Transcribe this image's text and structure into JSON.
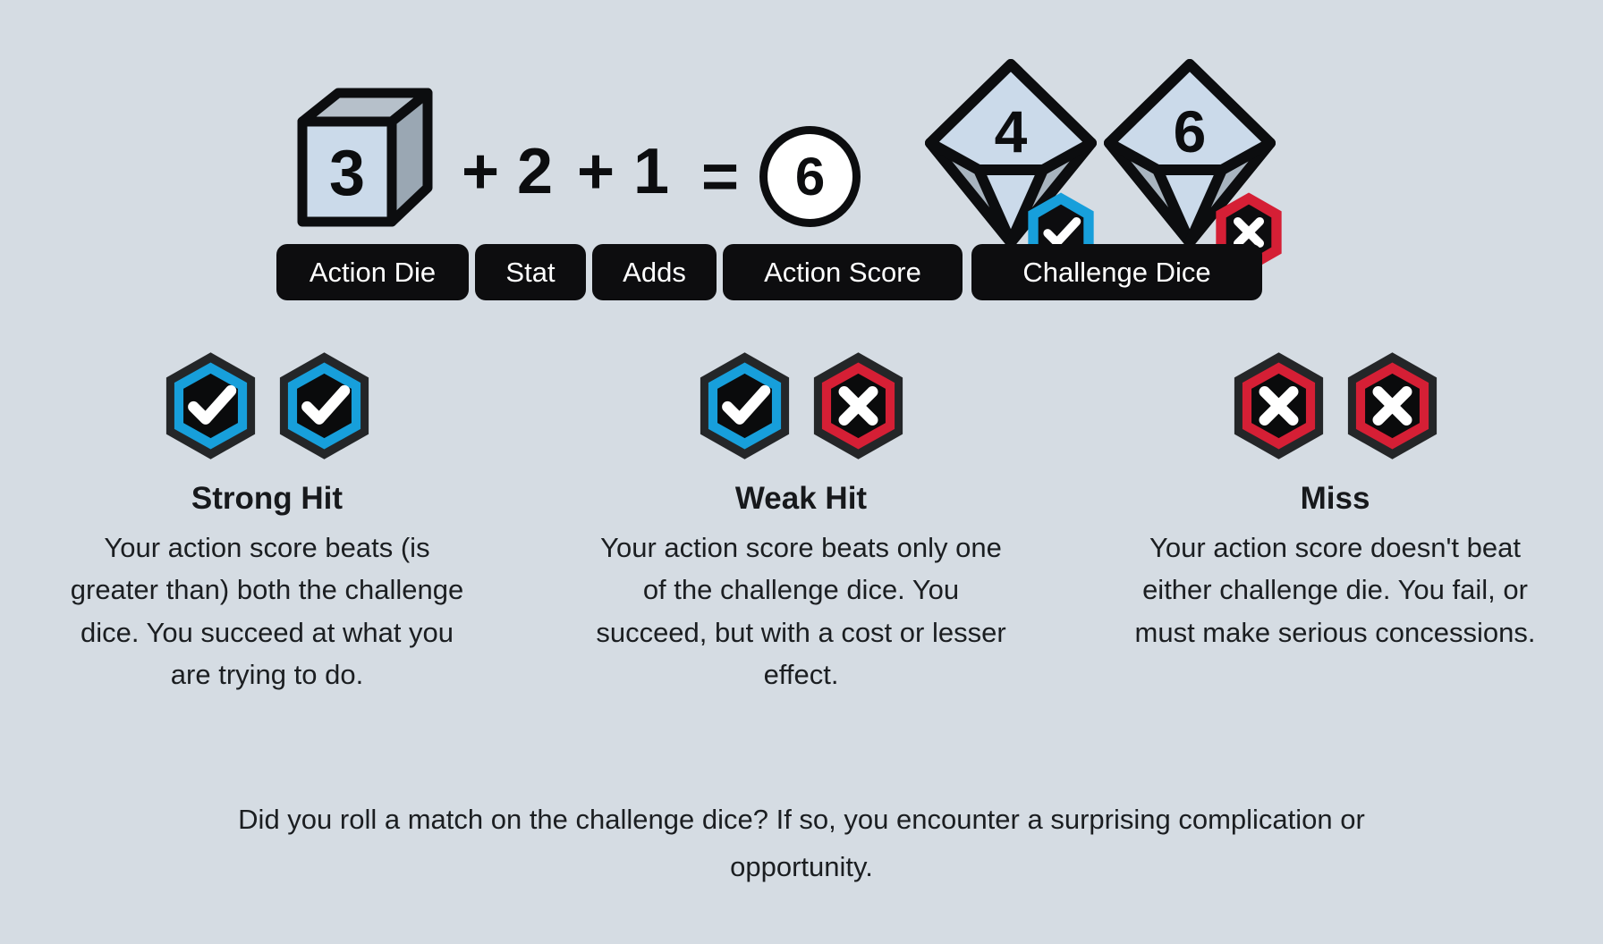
{
  "background_color": "#d5dce3",
  "colors": {
    "blue": "#179fdb",
    "red": "#d51f35",
    "black": "#0d0d0f",
    "die_face_light": "#cbdaea",
    "die_face_mid": "#a8b4bf",
    "die_face_dark": "#97a4b0",
    "text": "#1b1e21",
    "white": "#ffffff"
  },
  "formula": {
    "action_die": {
      "icon": "cube-die-icon",
      "value": "3"
    },
    "plus_1": "+",
    "stat_value": "2",
    "plus_2": "+",
    "adds_value": "1",
    "equals": "=",
    "action_score": {
      "icon": "circle-score-icon",
      "value": "6"
    },
    "challenge_dice": [
      {
        "icon": "d10-die-icon",
        "value": "4",
        "badge": "check-hex-icon",
        "badge_color": "#179fdb"
      },
      {
        "icon": "d10-die-icon",
        "value": "6",
        "badge": "cross-hex-icon",
        "badge_color": "#d51f35"
      }
    ],
    "labels": {
      "action_die": "Action Die",
      "stat": "Stat",
      "adds": "Adds",
      "action_score": "Action Score",
      "challenge_dice": "Challenge Dice"
    }
  },
  "outcomes": [
    {
      "id": "strong-hit",
      "title": "Strong Hit",
      "description": "Your action score beats (is greater than) both the challenge dice. You succeed at what you are trying to do.",
      "badges": [
        {
          "icon": "check-hex-icon",
          "color": "#179fdb"
        },
        {
          "icon": "check-hex-icon",
          "color": "#179fdb"
        }
      ]
    },
    {
      "id": "weak-hit",
      "title": "Weak Hit",
      "description": "Your action score beats only one of the challenge dice. You succeed, but with a cost or lesser effect.",
      "badges": [
        {
          "icon": "check-hex-icon",
          "color": "#179fdb"
        },
        {
          "icon": "cross-hex-icon",
          "color": "#d51f35"
        }
      ]
    },
    {
      "id": "miss",
      "title": "Miss",
      "description": "Your action score doesn't beat either challenge die. You fail, or must make serious concessions.",
      "badges": [
        {
          "icon": "cross-hex-icon",
          "color": "#d51f35"
        },
        {
          "icon": "cross-hex-icon",
          "color": "#d51f35"
        }
      ]
    }
  ],
  "footnote": "Did you roll a match on the challenge dice? If so, you encounter a surprising complication or opportunity."
}
